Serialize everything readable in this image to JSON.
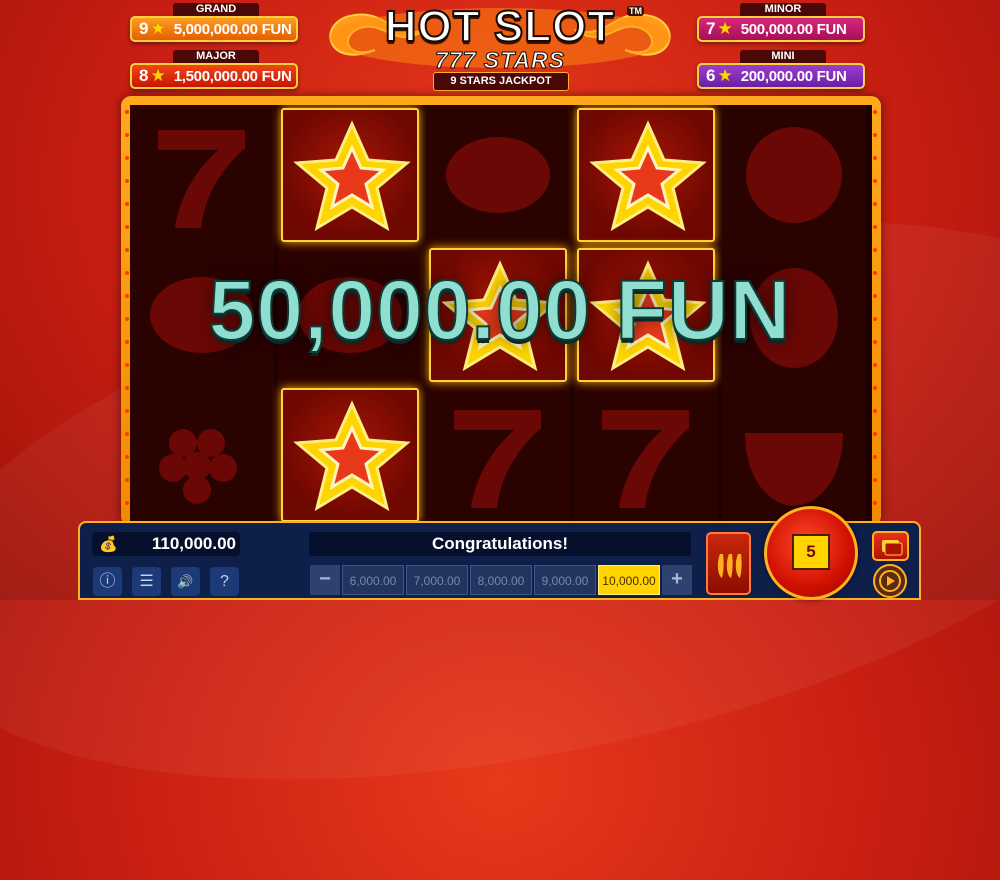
{
  "jackpots": {
    "grand": {
      "label": "GRAND",
      "count": "9",
      "value": "5,000,000.00 FUN"
    },
    "major": {
      "label": "MAJOR",
      "count": "8",
      "value": "1,500,000.00 FUN"
    },
    "minor": {
      "label": "MINOR",
      "count": "7",
      "value": "500,000.00 FUN"
    },
    "mini": {
      "label": "MINI",
      "count": "6",
      "value": "200,000.00 FUN"
    }
  },
  "logo": {
    "title": "HOT SLOT",
    "trademark": "TM",
    "subtitle": "777 STARS",
    "tagline": "9 STARS JACKPOT"
  },
  "reels": [
    [
      "seven",
      "lemon",
      "grapes"
    ],
    [
      "star",
      "lemon",
      "star"
    ],
    [
      "lemon",
      "star",
      "seven"
    ],
    [
      "star",
      "star",
      "seven"
    ],
    [
      "orange",
      "plum",
      "melon"
    ]
  ],
  "win_positions": [
    [
      1,
      0
    ],
    [
      1,
      2
    ],
    [
      2,
      1
    ],
    [
      3,
      0
    ],
    [
      3,
      1
    ]
  ],
  "win_amount": "50,000.00 FUN",
  "balance": {
    "icon": "money-bag-icon",
    "value": "110,000.00"
  },
  "message": "Congratulations!",
  "bet": {
    "minus": "−",
    "plus": "+",
    "options": [
      "6,000.00",
      "7,000.00",
      "8,000.00",
      "9,000.00",
      "10,000.00"
    ],
    "selected_index": 4
  },
  "controls": {
    "info": "ⓘ",
    "menu": "☰",
    "sound": "🔊",
    "help": "?"
  },
  "spin_count": "5",
  "colors": {
    "accent_gold": "#ffd23a",
    "win_text": "#8fded0",
    "panel": "#0e1f4a"
  }
}
